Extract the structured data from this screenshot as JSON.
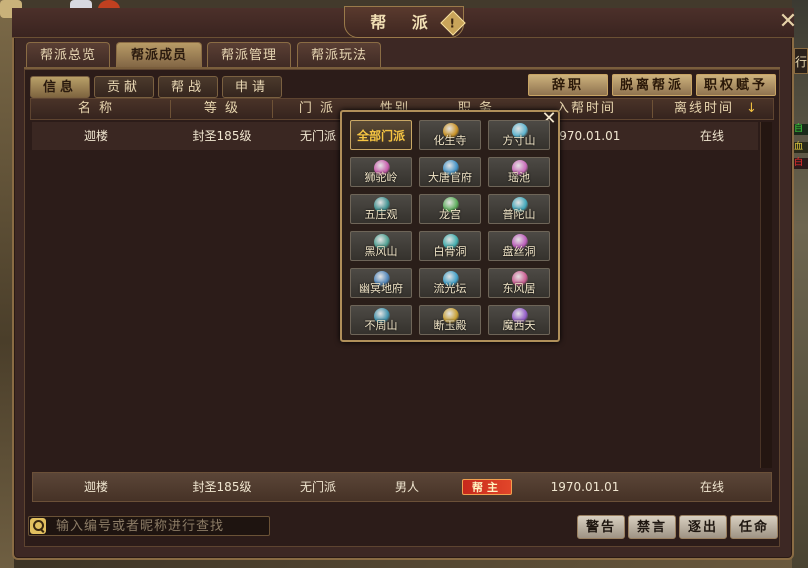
{
  "window": {
    "title": "帮 派",
    "help": "!",
    "close": "✕"
  },
  "right_edge": {
    "tab": "行",
    "line1": "自",
    "line2": "血",
    "line3": "白"
  },
  "tabs": [
    {
      "label": "帮派总览"
    },
    {
      "label": "帮派成员",
      "active": true
    },
    {
      "label": "帮派管理"
    },
    {
      "label": "帮派玩法"
    }
  ],
  "subtabs": [
    {
      "label": "信息",
      "active": true
    },
    {
      "label": "贡献"
    },
    {
      "label": "帮战"
    },
    {
      "label": "申请"
    }
  ],
  "actions": {
    "resign": "辞职",
    "leave": "脱离帮派",
    "grant": "职权赋予"
  },
  "table": {
    "columns": [
      "名称",
      "等级",
      "门派",
      "性别",
      "职务",
      "入帮时间",
      "离线时间"
    ],
    "sort_icon": "arrow-down-icon",
    "visible_header_fragments": {
      "name": "名 称",
      "level": "等 级",
      "sect": "门 派",
      "gender": "性别",
      "duty": "职 务",
      "join": "入帮时间",
      "offline": "离线时间"
    },
    "rows": [
      {
        "name": "迦楼",
        "level": "封圣185级",
        "sect": "无门派",
        "join": "1970.01.01",
        "status": "在线"
      }
    ]
  },
  "self_row": {
    "name": "迦楼",
    "level": "封圣185级",
    "sect": "无门派",
    "gender": "男人",
    "duty": "帮主",
    "join": "1970.01.01",
    "status": "在线"
  },
  "search": {
    "placeholder": "输入编号或者昵称进行查找"
  },
  "bottom_buttons": {
    "warn": "警告",
    "mute": "禁言",
    "kick": "逐出",
    "appoint": "任命"
  },
  "sect_filter": {
    "close": "✕",
    "options": [
      {
        "label": "全部门派",
        "selected": true,
        "color": ""
      },
      {
        "label": "化生寺",
        "color": "#e0a020"
      },
      {
        "label": "方寸山",
        "color": "#60c8e8"
      },
      {
        "label": "狮驼岭",
        "color": "#e060c0"
      },
      {
        "label": "大唐官府",
        "color": "#40a0e0"
      },
      {
        "label": "瑶池",
        "color": "#e070d0"
      },
      {
        "label": "五庄观",
        "color": "#40a0a0"
      },
      {
        "label": "龙宫",
        "color": "#60c060"
      },
      {
        "label": "普陀山",
        "color": "#40b8d0"
      },
      {
        "label": "黑风山",
        "color": "#50b0a0"
      },
      {
        "label": "白骨洞",
        "color": "#40c0c0"
      },
      {
        "label": "盘丝洞",
        "color": "#d060d0"
      },
      {
        "label": "幽冥地府",
        "color": "#5090d0"
      },
      {
        "label": "流光坛",
        "color": "#40b0e0"
      },
      {
        "label": "东风居",
        "color": "#e060a0"
      },
      {
        "label": "不周山",
        "color": "#40a0c0"
      },
      {
        "label": "断玉殿",
        "color": "#e0b030"
      },
      {
        "label": "魔西天",
        "color": "#a060e0"
      }
    ]
  }
}
